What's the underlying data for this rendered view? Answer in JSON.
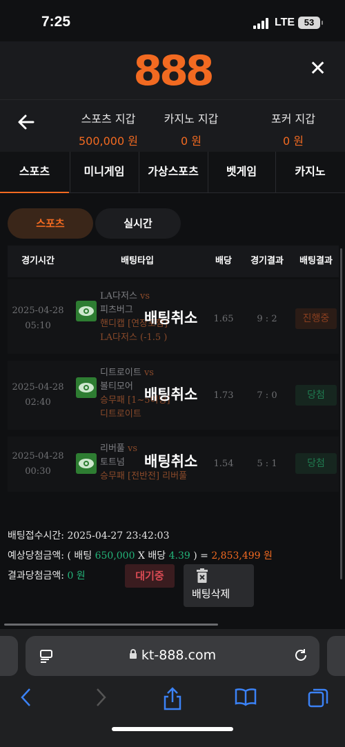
{
  "status": {
    "time": "7:25",
    "network": "LTE",
    "battery": "53"
  },
  "header": {
    "logo": "888"
  },
  "wallets": [
    {
      "label": "스포츠 지갑",
      "value": "500,000 원"
    },
    {
      "label": "카지노 지갑",
      "value": "0 원"
    },
    {
      "label": "포커 지갑",
      "value": "0 원"
    }
  ],
  "tabs": [
    "스포츠",
    "미니게임",
    "가상스포츠",
    "벳게임",
    "카지노"
  ],
  "subtabs": [
    "스포츠",
    "실시간"
  ],
  "table": {
    "headers": [
      "경기시간",
      "배팅타입",
      "배당",
      "경기결과",
      "배팅결과"
    ],
    "rows": [
      {
        "date": "2025-04-28",
        "time": "05:10",
        "team1": "LA다저스",
        "vs": "vs",
        "team2": "피츠버그",
        "type": "핸디캡 [연장포함]",
        "pick": "LA다저스 (-1.5 )",
        "cancel": "배팅취소",
        "odds": "1.65",
        "score": "9 : 2",
        "result": "진행중"
      },
      {
        "date": "2025-04-28",
        "time": "02:40",
        "team1": "디트로이트",
        "vs": "vs",
        "team2": "볼티모어",
        "type": "승무패 [1~5이닝]",
        "pick": "디트로이트",
        "cancel": "배팅취소",
        "odds": "1.73",
        "score": "7 : 0",
        "result": "당첨"
      },
      {
        "date": "2025-04-28",
        "time": "00:30",
        "team1": "리버풀",
        "vs": "vs",
        "team2": "토트넘",
        "type": "승무패 [전반전] 리버풀",
        "pick": "",
        "cancel": "배팅취소",
        "odds": "1.54",
        "score": "5 : 1",
        "result": "당첨"
      }
    ]
  },
  "summary": {
    "received_label": "배팅접수시간:",
    "received_value": "2025-04-27 23:42:03",
    "expected_label": "예상당첨금액:",
    "expected_open": "( 배팅",
    "bet_amount": "650,000",
    "x_odds": "X 배당",
    "total_odds": "4.39",
    "expected_close": ") =",
    "expected_value": "2,853,499 원",
    "result_label": "결과당첨금액:",
    "result_value": "0 원",
    "status_button": "대기중",
    "delete_button": "배팅삭제"
  },
  "browser": {
    "url": "kt-888.com"
  },
  "colors": {
    "accent": "#f26a21",
    "win": "#23b479",
    "danger": "#d84a53"
  }
}
